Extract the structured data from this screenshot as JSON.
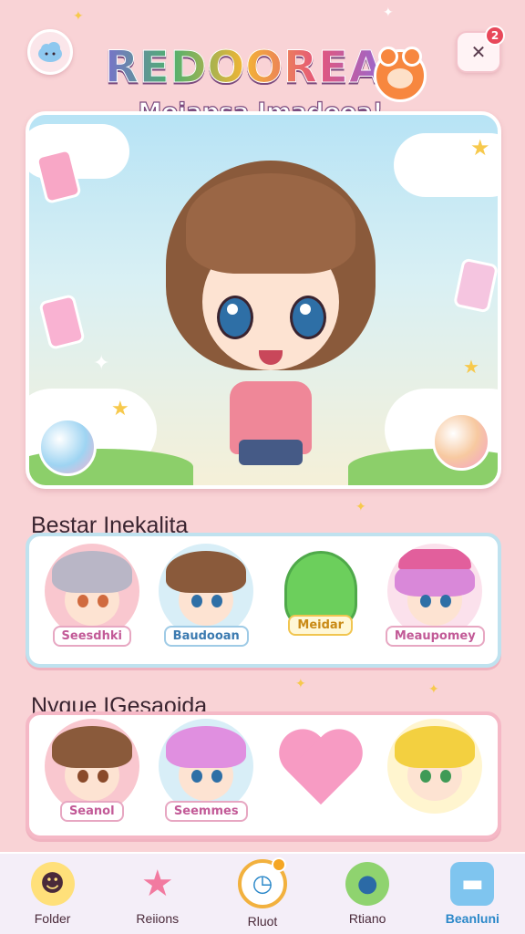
{
  "header": {
    "title": "REDOOREA",
    "subtitle": "Moiapsa Imadooa!",
    "notification_count": "2",
    "close_glyph": "✕"
  },
  "sections": [
    {
      "label": "Bestar Inekalita",
      "items": [
        {
          "label": "Seesdhki",
          "icon": "silver-hair-character"
        },
        {
          "label": "Baudooan",
          "icon": "brown-hair-character"
        },
        {
          "label": "Meidar",
          "icon": "green-slime"
        },
        {
          "label": "Meaupomey",
          "icon": "pink-hat-character"
        }
      ]
    },
    {
      "label": "Nygue IGesaoida",
      "items": [
        {
          "label": "Seanol",
          "icon": "brown-hair-boy"
        },
        {
          "label": "Seemmes",
          "icon": "pink-hair-girl"
        },
        {
          "label": "",
          "icon": "pink-heart"
        },
        {
          "label": "",
          "icon": "cat-ear-character"
        }
      ]
    }
  ],
  "bottom_nav": [
    {
      "label": "Folder",
      "icon": "sun-face-icon",
      "active": false
    },
    {
      "label": "Reiions",
      "icon": "star-icon",
      "active": false
    },
    {
      "label": "Rluot",
      "icon": "clock-icon",
      "active": false
    },
    {
      "label": "Rtiano",
      "icon": "creature-icon",
      "active": false
    },
    {
      "label": "Beanluni",
      "icon": "card-icon",
      "active": true
    }
  ],
  "colors": {
    "background": "#f9d3d6",
    "accent_blue": "#2b88c9",
    "badge_red": "#e8485a"
  }
}
